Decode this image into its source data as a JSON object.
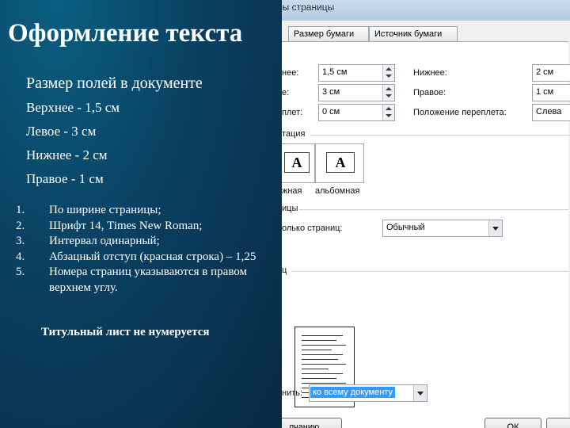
{
  "slide": {
    "title": "Оформление текста",
    "margins_heading": "Размер полей в документе",
    "margins": [
      "Верхнее - 1,5 см",
      "Левое - 3 см",
      "Нижнее - 2 см",
      "Правое - 1 см"
    ],
    "rules": [
      {
        "num": "1.",
        "text": "По ширине страницы;"
      },
      {
        "num": "2.",
        "text": "Шрифт 14, Times New Roman;"
      },
      {
        "num": "3.",
        "text": "Интервал одинарный;"
      },
      {
        "num": "4.",
        "text": "Абзацный отступ (красная строка) – 1,25"
      },
      {
        "num": "5.",
        "text": "Номера страниц указываются в правом верхнем углу."
      }
    ],
    "note": "Титульный лист не нумеруется"
  },
  "dialog": {
    "title": "ры страницы",
    "tabs": [
      "Размер бумаги",
      "Источник бумаги"
    ],
    "fields": {
      "top_label": "нее:",
      "top_value": "1,5 см",
      "left_label": "е:",
      "left_value": "3 см",
      "gutter_label": "плет:",
      "gutter_value": "0 см",
      "bottom_label": "Нижнее:",
      "bottom_value": "2 см",
      "right_label": "Правое:",
      "right_value": "1 см",
      "gutter_pos_label": "Положение переплета:",
      "gutter_pos_value": "Слева"
    },
    "orientation_section": "тация",
    "orientation_portrait": "жная",
    "orientation_landscape": "альбомная",
    "orientation_glyph": "A",
    "pages_section": "ицы",
    "pages_label": "олько страниц:",
    "pages_value": "Обычный",
    "preview_section": "ц",
    "apply_label": "нить:",
    "apply_value": "ко всему документу",
    "default_button": "лчанию",
    "ok_button": "ОК"
  }
}
